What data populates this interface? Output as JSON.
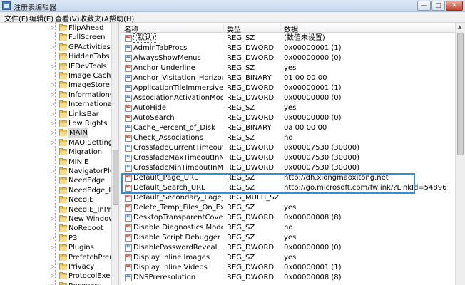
{
  "window": {
    "title": "注册表编辑器",
    "buttons": {
      "minimize": "—",
      "maximize": "□",
      "close": "✕"
    }
  },
  "menu": [
    "文件(F)",
    "编辑(E)",
    "查看(V)",
    "收藏夹(A)",
    "帮助(H)"
  ],
  "tree": {
    "selected": "MAIN",
    "items": [
      {
        "label": "FlipAhead",
        "expandable": true
      },
      {
        "label": "FullScreen",
        "expandable": false
      },
      {
        "label": "GPActivities",
        "expandable": true
      },
      {
        "label": "HiddenTabs",
        "expandable": false
      },
      {
        "label": "IEDevTools",
        "expandable": true
      },
      {
        "label": "Image Caching",
        "expandable": false
      },
      {
        "label": "ImageStore",
        "expandable": true
      },
      {
        "label": "InformationCar",
        "expandable": true
      },
      {
        "label": "International",
        "expandable": true
      },
      {
        "label": "LinksBar",
        "expandable": true
      },
      {
        "label": "Low Rights",
        "expandable": true
      },
      {
        "label": "MAIN",
        "expandable": true
      },
      {
        "label": "MAO Settings",
        "expandable": true
      },
      {
        "label": "Migration",
        "expandable": false
      },
      {
        "label": "MINIE",
        "expandable": false
      },
      {
        "label": "NavigatorPlugi",
        "expandable": true
      },
      {
        "label": "NeedEdge",
        "expandable": false
      },
      {
        "label": "NeedEdge_InPr",
        "expandable": false
      },
      {
        "label": "NeedIE",
        "expandable": false
      },
      {
        "label": "NeedIE_InPrivat",
        "expandable": false
      },
      {
        "label": "New Windows",
        "expandable": true
      },
      {
        "label": "NoReboot",
        "expandable": false
      },
      {
        "label": "P3",
        "expandable": true
      },
      {
        "label": "Plugins",
        "expandable": true
      },
      {
        "label": "PrefetchPrerend",
        "expandable": false
      },
      {
        "label": "Privacy",
        "expandable": true
      },
      {
        "label": "ProtocolExecut",
        "expandable": true
      },
      {
        "label": "Recovery",
        "expandable": true
      }
    ]
  },
  "list": {
    "columns": {
      "name": "名称",
      "type": "类型",
      "data": "数据"
    },
    "rows": [
      {
        "kind": "sz",
        "name": "(默认)",
        "type": "REG_SZ",
        "data": "(数值未设置)",
        "is_default": true
      },
      {
        "kind": "bin",
        "name": "AdminTabProcs",
        "type": "REG_DWORD",
        "data": "0x00000001 (1)"
      },
      {
        "kind": "bin",
        "name": "AlwaysShowMenus",
        "type": "REG_DWORD",
        "data": "0x00000000 (0)"
      },
      {
        "kind": "sz",
        "name": "Anchor Underline",
        "type": "REG_SZ",
        "data": "yes"
      },
      {
        "kind": "bin",
        "name": "Anchor_Visitation_Horizon",
        "type": "REG_BINARY",
        "data": "01 00 00 00"
      },
      {
        "kind": "bin",
        "name": "ApplicationTileImmersiveActiva...",
        "type": "REG_DWORD",
        "data": "0x00000001 (1)"
      },
      {
        "kind": "bin",
        "name": "AssociationActivationMode",
        "type": "REG_DWORD",
        "data": "0x00000000 (0)"
      },
      {
        "kind": "sz",
        "name": "AutoHide",
        "type": "REG_SZ",
        "data": "yes"
      },
      {
        "kind": "sz",
        "name": "AutoSearch",
        "type": "REG_DWORD",
        "data": "0x00000000 (0)"
      },
      {
        "kind": "bin",
        "name": "Cache_Percent_of_Disk",
        "type": "REG_BINARY",
        "data": "0a 00 00 00"
      },
      {
        "kind": "sz",
        "name": "Check_Associations",
        "type": "REG_SZ",
        "data": "no"
      },
      {
        "kind": "bin",
        "name": "CrossfadeCurrentTimeoutInMS",
        "type": "REG_DWORD",
        "data": "0x00007530 (30000)"
      },
      {
        "kind": "bin",
        "name": "CrossfadeMaxTimeoutInMS",
        "type": "REG_DWORD",
        "data": "0x00007530 (30000)"
      },
      {
        "kind": "bin",
        "name": "CrossfadeMinTimeoutInMS",
        "type": "REG_DWORD",
        "data": "0x00007530 (30000)"
      },
      {
        "kind": "sz",
        "name": "Default_Page_URL",
        "type": "REG_SZ",
        "data": "http://dh.xiongmaoxitong.net"
      },
      {
        "kind": "sz",
        "name": "Default_Search_URL",
        "type": "REG_SZ",
        "data": "http://go.microsoft.com/fwlink/?LinkId=54896"
      },
      {
        "kind": "sz",
        "name": "Default_Secondary_Page_URL",
        "type": "REG_MULTI_SZ",
        "data": ""
      },
      {
        "kind": "sz",
        "name": "Delete_Temp_Files_On_Exit",
        "type": "REG_SZ",
        "data": "yes"
      },
      {
        "kind": "bin",
        "name": "DesktopTransparentCoverWin...",
        "type": "REG_DWORD",
        "data": "0x00000008 (8)"
      },
      {
        "kind": "sz",
        "name": "Disable Diagnostics Mode",
        "type": "REG_SZ",
        "data": "no"
      },
      {
        "kind": "sz",
        "name": "Disable Script Debugger",
        "type": "REG_SZ",
        "data": "yes"
      },
      {
        "kind": "bin",
        "name": "DisablePasswordReveal",
        "type": "REG_DWORD",
        "data": "0x00000000 (0)"
      },
      {
        "kind": "sz",
        "name": "Display Inline Images",
        "type": "REG_SZ",
        "data": "yes"
      },
      {
        "kind": "sz",
        "name": "Display Inline Videos",
        "type": "REG_DWORD",
        "data": "0x00000001 (1)"
      },
      {
        "kind": "bin",
        "name": "DNSPreresolution",
        "type": "REG_DWORD",
        "data": "0x00000008 (8)"
      }
    ]
  },
  "colors": {
    "highlight_border": "#2e8fd3",
    "folder": "#e7c35a"
  }
}
